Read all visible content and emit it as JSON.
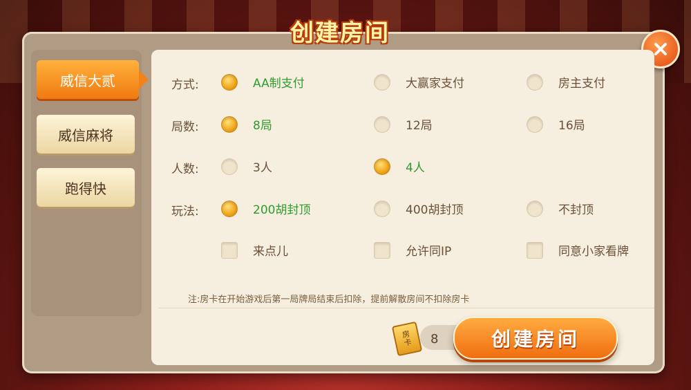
{
  "title": "创建房间",
  "tabs": [
    {
      "label": "威信大贰",
      "active": true
    },
    {
      "label": "威信麻将",
      "active": false
    },
    {
      "label": "跑得快",
      "active": false
    }
  ],
  "rows": [
    {
      "label": "方式:",
      "options": [
        {
          "text": "AA制支付",
          "selected": true
        },
        {
          "text": "大赢家支付",
          "selected": false
        },
        {
          "text": "房主支付",
          "selected": false
        }
      ]
    },
    {
      "label": "局数:",
      "options": [
        {
          "text": "8局",
          "selected": true
        },
        {
          "text": "12局",
          "selected": false
        },
        {
          "text": "16局",
          "selected": false
        }
      ]
    },
    {
      "label": "人数:",
      "options": [
        {
          "text": "3人",
          "selected": false
        },
        {
          "text": "4人",
          "selected": true
        }
      ]
    },
    {
      "label": "玩法:",
      "options": [
        {
          "text": "200胡封顶",
          "selected": true
        },
        {
          "text": "400胡封顶",
          "selected": false
        },
        {
          "text": "不封顶",
          "selected": false
        }
      ]
    }
  ],
  "checkboxes": [
    {
      "text": "来点儿",
      "checked": false
    },
    {
      "text": "允许同IP",
      "checked": false
    },
    {
      "text": "同意小家看牌",
      "checked": false
    }
  ],
  "note": "注:房卡在开始游戏后第一局牌局结束后扣除，提前解散房间不扣除房卡",
  "cost": {
    "card_label": "房卡",
    "card_label_top": "房",
    "card_label_bottom": "卡",
    "count": "8"
  },
  "create_button": "创建房间",
  "icons": {
    "close": "close-icon",
    "card": "room-card-icon"
  },
  "colors": {
    "accent": "#f0811e",
    "selected_text": "#2e9b2e",
    "panel": "#f6efdf"
  }
}
